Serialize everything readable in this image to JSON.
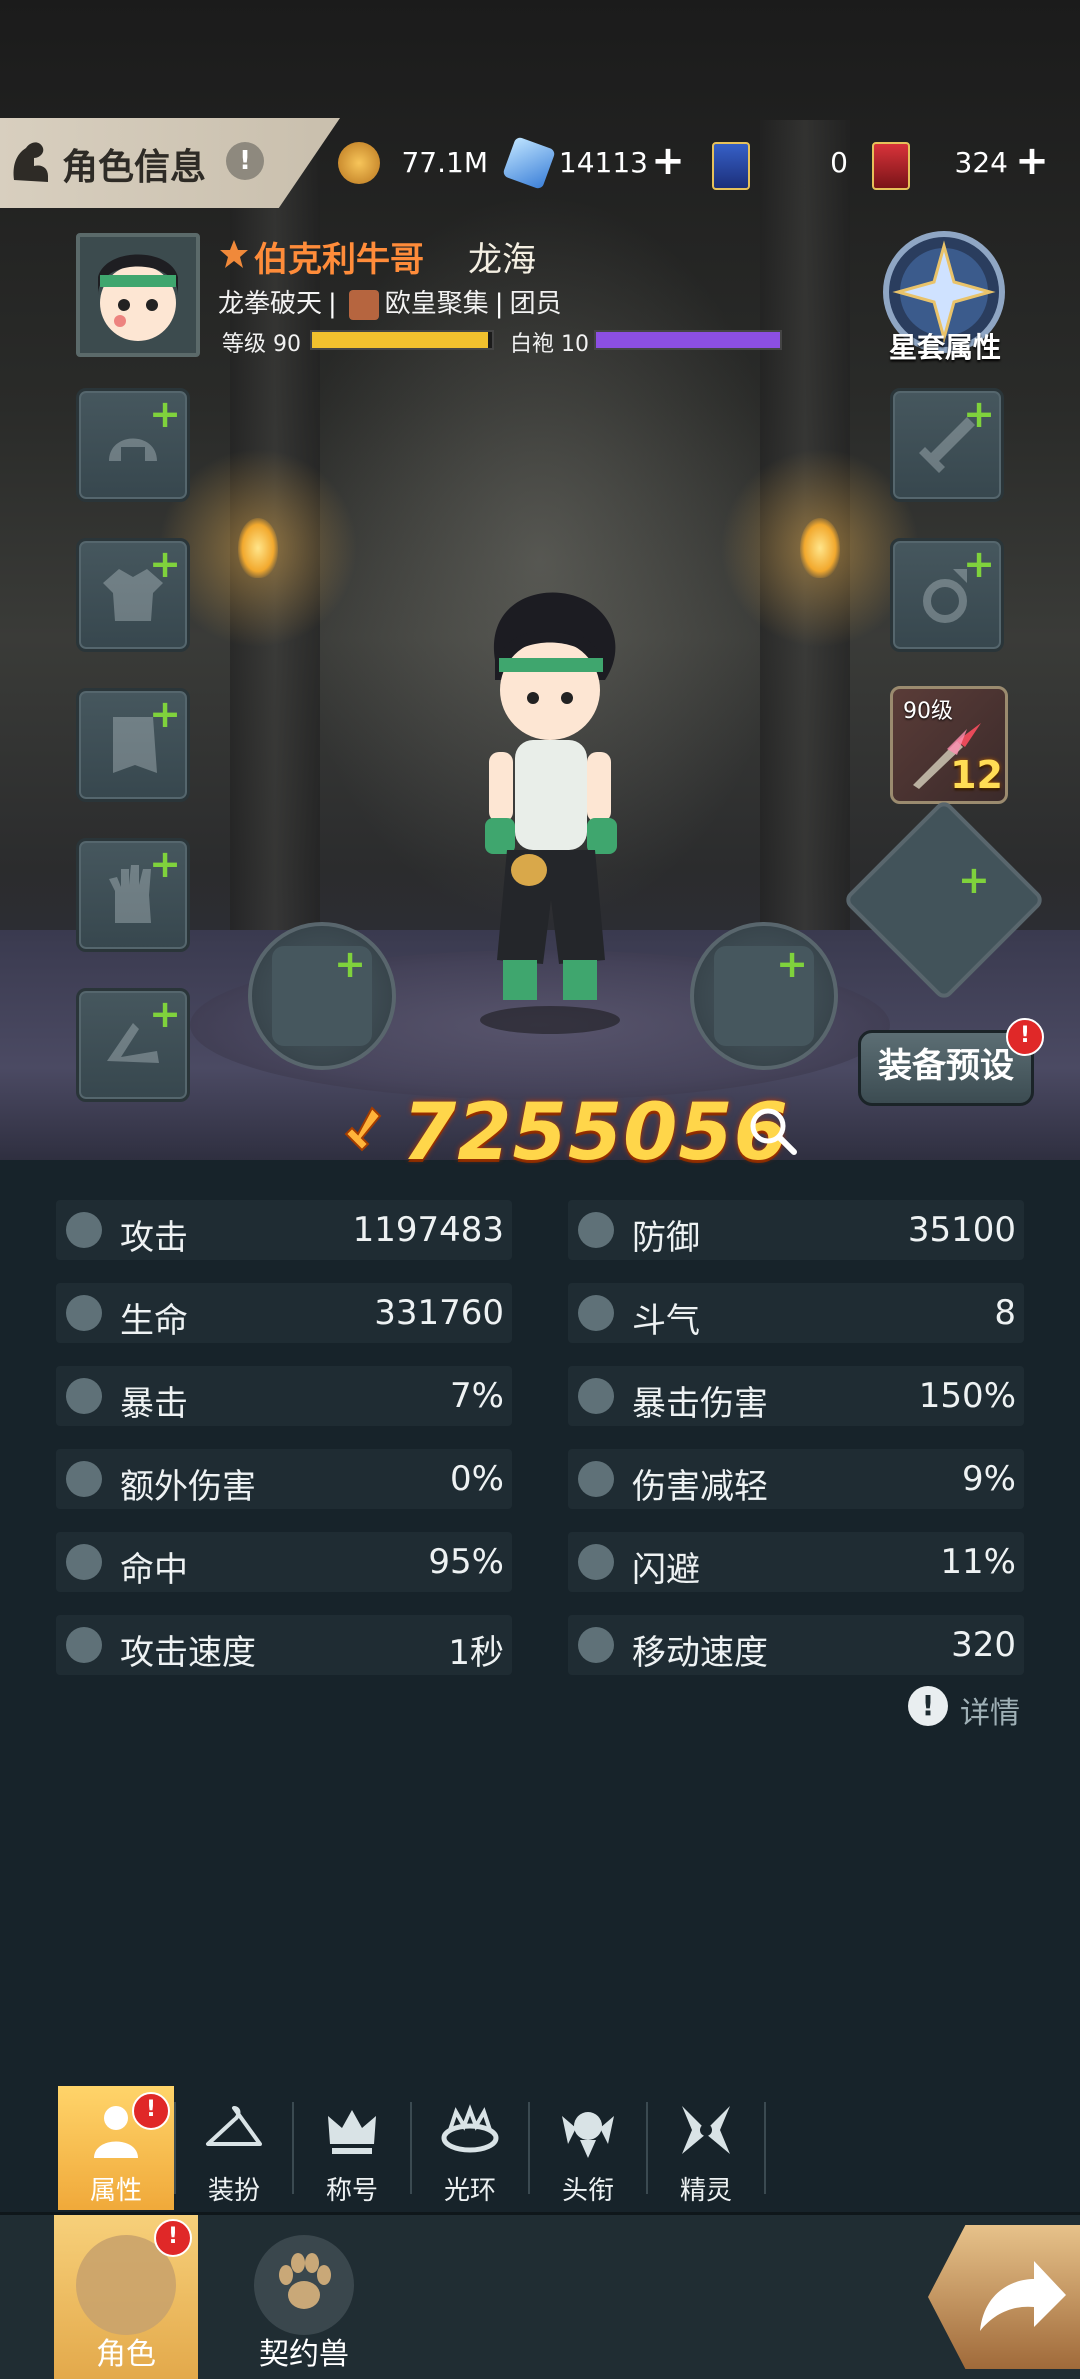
{
  "header": {
    "title": "角色信息",
    "resources": [
      {
        "icon": "gold-coin-icon",
        "value": "77.1M"
      },
      {
        "icon": "blue-crystal-icon",
        "value": "14113"
      },
      {
        "icon": "blue-card-icon",
        "value": "0"
      },
      {
        "icon": "red-card-icon",
        "value": "324"
      }
    ]
  },
  "character": {
    "name": "伯克利牛哥",
    "server": "龙海",
    "title_prefix": "龙拳破天",
    "guild": "欧皇聚集",
    "guild_role": "团员",
    "level_label": "等级 90",
    "level_progress": 0.98,
    "rank_label": "白袍 10",
    "rank_progress": 1.0
  },
  "star_set": {
    "label": "星套属性"
  },
  "weapon": {
    "level": "90级",
    "plus": "12"
  },
  "preset": {
    "label": "装备预设",
    "badge": "!"
  },
  "power": {
    "value": "7255056"
  },
  "stats": [
    {
      "icon": "attack-icon",
      "label": "攻击",
      "value": "1197483"
    },
    {
      "icon": "defense-icon",
      "label": "防御",
      "value": "35100"
    },
    {
      "icon": "health-icon",
      "label": "生命",
      "value": "331760"
    },
    {
      "icon": "fighting-spirit-icon",
      "label": "斗气",
      "value": "8"
    },
    {
      "icon": "crit-icon",
      "label": "暴击",
      "value": "7%"
    },
    {
      "icon": "crit-damage-icon",
      "label": "暴击伤害",
      "value": "150%"
    },
    {
      "icon": "extra-damage-icon",
      "label": "额外伤害",
      "value": "0%"
    },
    {
      "icon": "damage-reduction-icon",
      "label": "伤害减轻",
      "value": "9%"
    },
    {
      "icon": "accuracy-icon",
      "label": "命中",
      "value": "95%"
    },
    {
      "icon": "dodge-icon",
      "label": "闪避",
      "value": "11%"
    },
    {
      "icon": "attack-speed-icon",
      "label": "攻击速度",
      "value": "1秒"
    },
    {
      "icon": "move-speed-icon",
      "label": "移动速度",
      "value": "320"
    }
  ],
  "details": {
    "label": "详情"
  },
  "subtabs": [
    {
      "label": "属性",
      "icon": "person-icon",
      "active": true,
      "badge": "!"
    },
    {
      "label": "装扮",
      "icon": "hanger-icon"
    },
    {
      "label": "称号",
      "icon": "crown-icon"
    },
    {
      "label": "光环",
      "icon": "halo-icon"
    },
    {
      "label": "头衔",
      "icon": "emblem-icon"
    },
    {
      "label": "精灵",
      "icon": "fairy-icon"
    }
  ],
  "bottom_nav": [
    {
      "label": "角色",
      "icon": "character-icon",
      "active": true,
      "badge": "!"
    },
    {
      "label": "契约兽",
      "icon": "paw-icon"
    }
  ],
  "colors": {
    "accent_gold": "#ffd64a",
    "name_orange": "#ff8c3a",
    "plus_green": "#7fd23c",
    "level_bar": "#f2c12e",
    "rank_bar": "#8c4fe3",
    "badge_red": "#e02828"
  }
}
